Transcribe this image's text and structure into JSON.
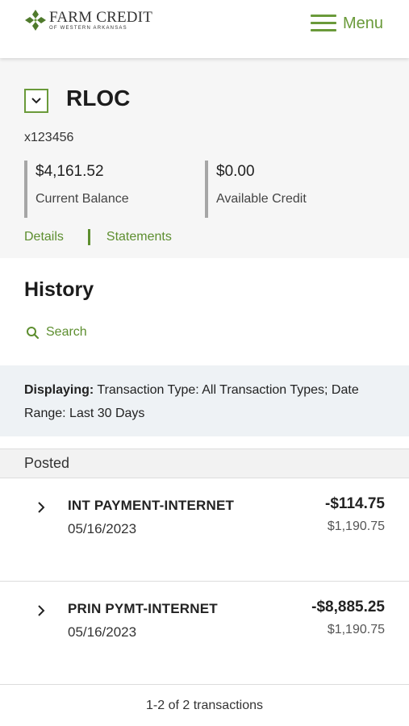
{
  "header": {
    "brand_name": "Farm Credit",
    "brand_sub": "of Western Arkansas",
    "menu_label": "Menu"
  },
  "account": {
    "name": "RLOC",
    "number": "x123456",
    "current_balance": "$4,161.52",
    "current_balance_label": "Current Balance",
    "available_credit": "$0.00",
    "available_credit_label": "Available Credit",
    "details_label": "Details",
    "statements_label": "Statements"
  },
  "history": {
    "title": "History",
    "search_label": "Search",
    "filter_prefix": "Displaying:",
    "filter_text": "Transaction Type: All Transaction Types; Date Range: Last 30 Days",
    "section_label": "Posted",
    "transactions": [
      {
        "description": "INT PAYMENT-INTERNET",
        "date": "05/16/2023",
        "amount": "-$114.75",
        "balance": "$1,190.75"
      },
      {
        "description": "PRIN PYMT-INTERNET",
        "date": "05/16/2023",
        "amount": "-$8,885.25",
        "balance": "$1,190.75"
      }
    ],
    "pagination": "1-2 of 2 transactions"
  },
  "colors": {
    "brand_green": "#6a9a3a",
    "link_green": "#5d8e2f",
    "filter_background": "#eef2f5"
  },
  "icons": {
    "logo": "farm-credit-leaf-logo",
    "menu": "hamburger-icon",
    "account_toggle": "chevron-down-icon",
    "search": "search-icon",
    "row_expand": "chevron-right-icon"
  }
}
